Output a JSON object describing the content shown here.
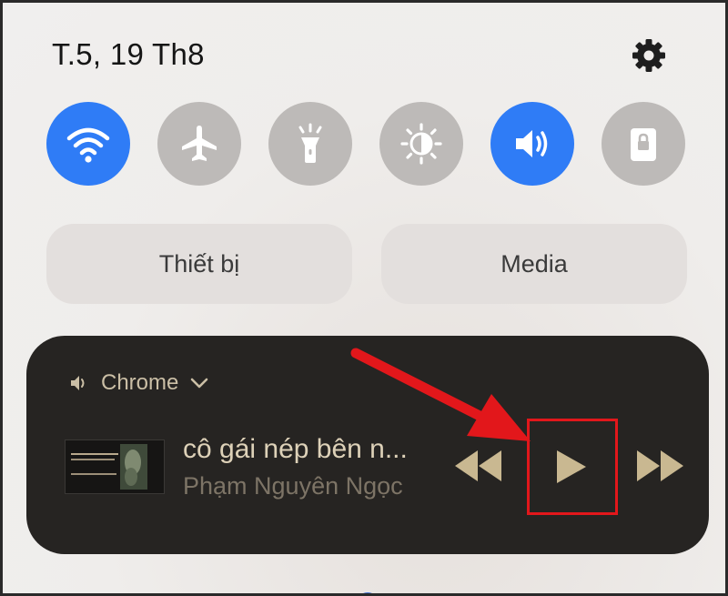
{
  "status": {
    "date": "T.5, 19 Th8"
  },
  "quick_settings": {
    "tiles": [
      {
        "name": "wifi",
        "state": "on"
      },
      {
        "name": "airplane",
        "state": "off"
      },
      {
        "name": "flashlight",
        "state": "off"
      },
      {
        "name": "brightness",
        "state": "off"
      },
      {
        "name": "sound",
        "state": "on"
      },
      {
        "name": "secure-folder",
        "state": "off"
      }
    ],
    "buttons": {
      "devices_label": "Thiết bị",
      "media_label": "Media"
    }
  },
  "media_player": {
    "source_app": "Chrome",
    "title": "cô gái nép bên n...",
    "artist": "Phạm Nguyên Ngọc"
  },
  "colors": {
    "accent": "#2f7cf6",
    "player_bg": "#262422",
    "player_control": "#c9b891",
    "annotation": "#e2171b"
  }
}
